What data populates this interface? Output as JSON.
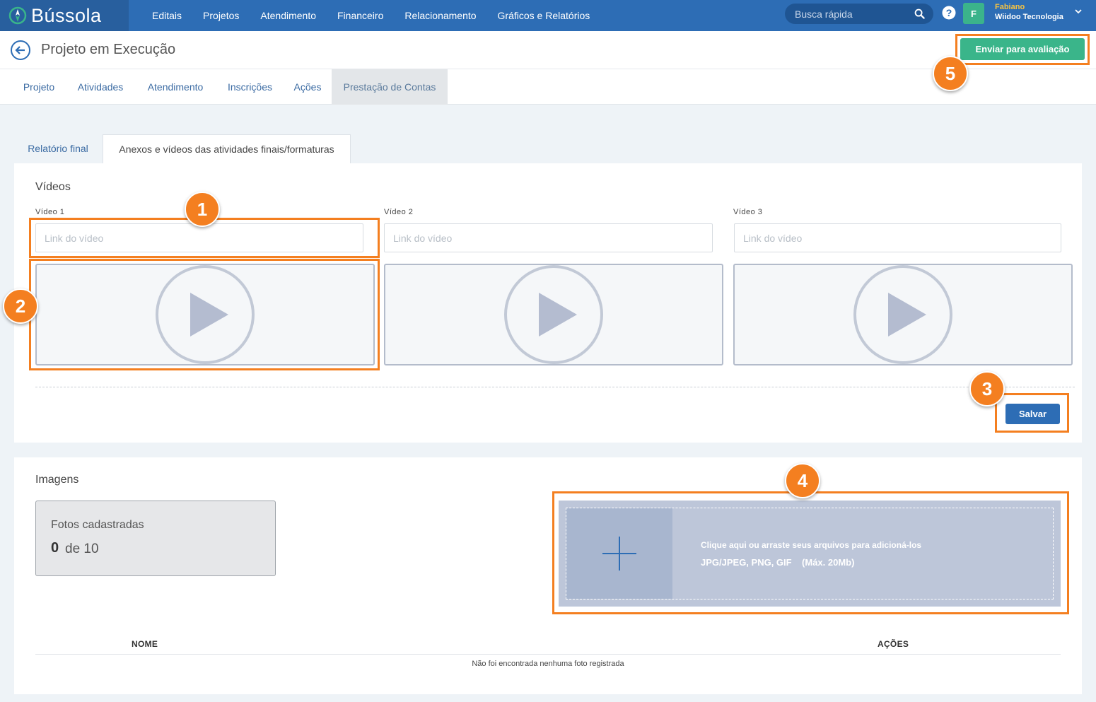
{
  "app": {
    "name": "Bússola"
  },
  "nav": {
    "items": [
      "Editais",
      "Projetos",
      "Atendimento",
      "Financeiro",
      "Relacionamento",
      "Gráficos e Relatórios"
    ],
    "search_placeholder": "Busca rápida",
    "user": {
      "initial": "F",
      "name": "Fabiano",
      "org": "Wiidoo Tecnologia"
    }
  },
  "header": {
    "title": "Projeto em Execução",
    "send_button": "Enviar para avaliação"
  },
  "main_tabs": [
    "Projeto",
    "Atividades",
    "Atendimento",
    "Inscrições",
    "Ações",
    "Prestação de Contas"
  ],
  "main_tab_active": "Prestação de Contas",
  "sub_tabs": [
    "Relatório final",
    "Anexos e vídeos das atividades finais/formaturas"
  ],
  "sub_tab_active": "Anexos e vídeos das atividades finais/formaturas",
  "videos": {
    "title": "Vídeos",
    "fields": [
      {
        "label": "Vídeo 1",
        "placeholder": "Link do vídeo",
        "value": ""
      },
      {
        "label": "Vídeo 2",
        "placeholder": "Link do vídeo",
        "value": ""
      },
      {
        "label": "Vídeo 3",
        "placeholder": "Link do vídeo",
        "value": ""
      }
    ],
    "save_button": "Salvar"
  },
  "images": {
    "title": "Imagens",
    "photos_label": "Fotos cadastradas",
    "photos_count": "0",
    "photos_max": "de 10",
    "dropzone_text": "Clique aqui ou arraste seus arquivos para adicioná-los",
    "dropzone_formats": "JPG/JPEG, PNG, GIF    (Máx. 20Mb)",
    "table": {
      "columns": [
        "NOME",
        "AÇÕES"
      ],
      "empty": "Não foi encontrada nenhuma foto registrada"
    }
  },
  "callouts": [
    "1",
    "2",
    "3",
    "4",
    "5"
  ],
  "colors": {
    "nav": "#2d6db5",
    "accent_green": "#3ab58a",
    "callout": "#f47f20",
    "primary": "#2d6db5"
  }
}
